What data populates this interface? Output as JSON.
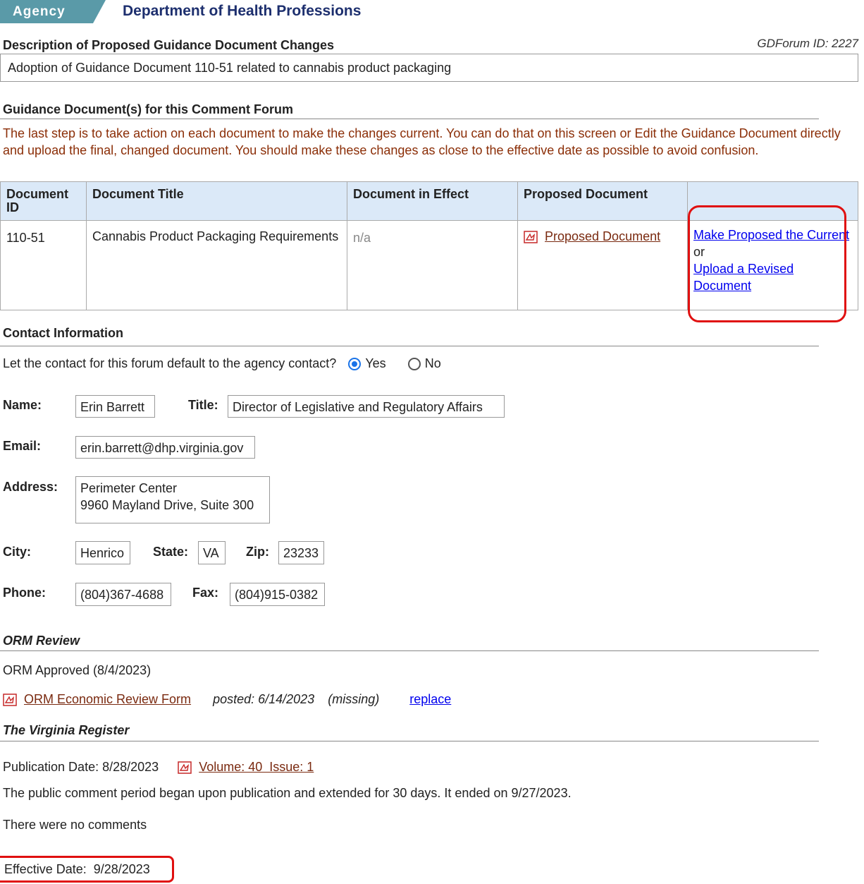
{
  "header": {
    "agency_tab": "Agency",
    "agency_name": "Department of Health Professions"
  },
  "description": {
    "heading": "Description of Proposed Guidance Document Changes",
    "forum_id": "GDForum ID: 2227",
    "text": "Adoption of Guidance Document 110-51 related to cannabis product packaging"
  },
  "guidance": {
    "heading": "Guidance Document(s) for this Comment Forum",
    "instructions": "The last step is to take action on each document to make the changes current. You can do that on this screen or Edit the Guidance Document directly and upload the final, changed document. You should make these changes as close to the effective date as possible to avoid confusion.",
    "columns": [
      "Document ID",
      "Document Title",
      "Document in Effect",
      "Proposed Document",
      ""
    ],
    "rows": [
      {
        "doc_id": "110-51",
        "title": "Cannabis Product Packaging Requirements",
        "in_effect": "n/a",
        "proposed_link": "Proposed Document",
        "action_make_current": "Make Proposed the Current",
        "action_or": "or",
        "action_upload": "Upload a Revised Document"
      }
    ]
  },
  "contact": {
    "heading": "Contact Information",
    "default_question": "Let the contact for this forum default to the agency contact?",
    "option_yes": "Yes",
    "option_no": "No",
    "selected": "Yes",
    "name_label": "Name:",
    "name": "Erin Barrett",
    "title_label": "Title:",
    "title": "Director of Legislative and Regulatory Affairs",
    "email_label": "Email:",
    "email": "erin.barrett@dhp.virginia.gov",
    "address_label": "Address:",
    "address_line1": "Perimeter Center",
    "address_line2": "9960 Mayland Drive, Suite 300",
    "city_label": "City:",
    "city": "Henrico",
    "state_label": "State:",
    "state": "VA",
    "zip_label": "Zip:",
    "zip": "23233",
    "phone_label": "Phone:",
    "phone": "(804)367-4688",
    "fax_label": "Fax:",
    "fax": "(804)915-0382"
  },
  "orm": {
    "heading": "ORM Review",
    "status": "ORM Approved (8/4/2023)",
    "form_link": "ORM Economic Review Form",
    "posted": "posted: 6/14/2023",
    "missing": "(missing)",
    "replace": "replace"
  },
  "register": {
    "heading": "The Virginia Register",
    "publication_label": "Publication Date: 8/28/2023",
    "volume_link": "Volume: 40  Issue: 1",
    "comment_period": "The public comment period began upon publication and extended for 30 days. It ended on 9/27/2023.",
    "no_comments": "There were no comments",
    "effective_date": "Effective Date:  9/28/2023"
  },
  "colors": {
    "accent_red": "#e01010",
    "link_blue": "#0000ee",
    "instruction_brown": "#8b2e07",
    "header_blue": "#dbe9f8"
  }
}
